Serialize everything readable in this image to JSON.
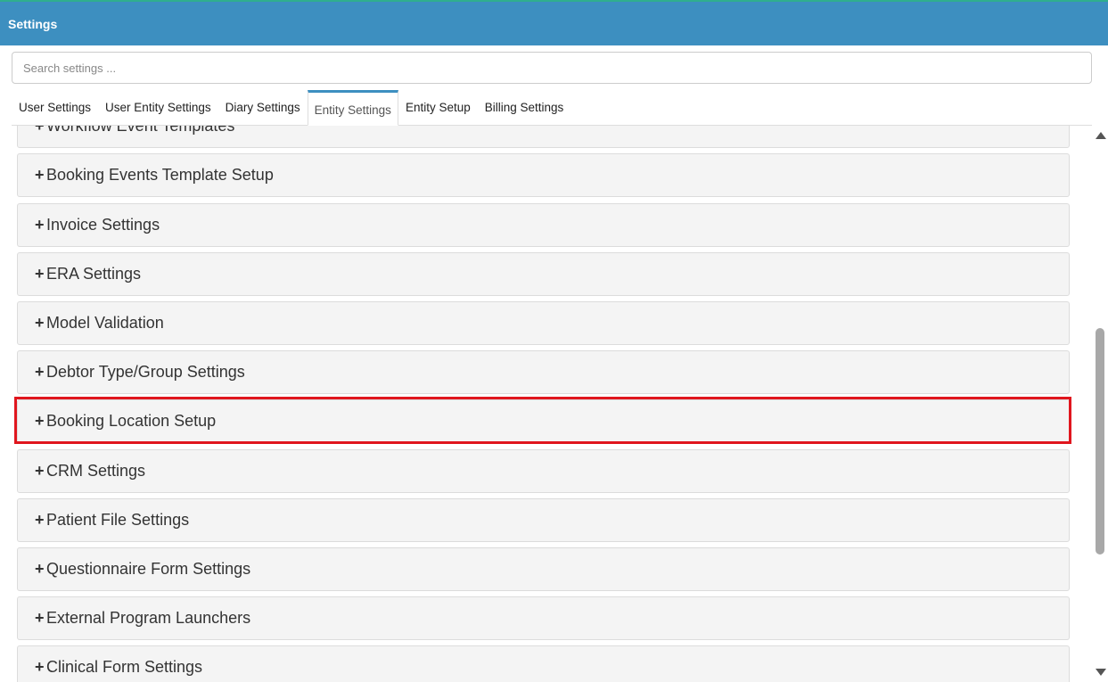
{
  "header": {
    "title": "Settings"
  },
  "search": {
    "placeholder": "Search settings ..."
  },
  "tabs": [
    {
      "label": "User Settings",
      "active": false
    },
    {
      "label": "User Entity Settings",
      "active": false
    },
    {
      "label": "Diary Settings",
      "active": false
    },
    {
      "label": "Entity Settings",
      "active": true
    },
    {
      "label": "Entity Setup",
      "active": false
    },
    {
      "label": "Billing Settings",
      "active": false
    }
  ],
  "panels": [
    {
      "label": "Workflow Event Templates"
    },
    {
      "label": "Booking Events Template Setup"
    },
    {
      "label": "Invoice Settings"
    },
    {
      "label": "ERA Settings"
    },
    {
      "label": "Model Validation"
    },
    {
      "label": "Debtor Type/Group Settings"
    },
    {
      "label": "Booking Location Setup",
      "highlighted": true
    },
    {
      "label": "CRM Settings"
    },
    {
      "label": "Patient File Settings"
    },
    {
      "label": "Questionnaire Form Settings"
    },
    {
      "label": "External Program Launchers"
    },
    {
      "label": "Clinical Form Settings"
    }
  ],
  "expand_symbol": "+",
  "colors": {
    "header": "#3d8fc0",
    "highlight": "#e0161e",
    "panel_bg": "#f4f4f4"
  },
  "icons": {
    "expand": "plus-icon",
    "scroll_up": "scroll-up-arrow-icon",
    "scroll_down": "scroll-down-arrow-icon"
  }
}
